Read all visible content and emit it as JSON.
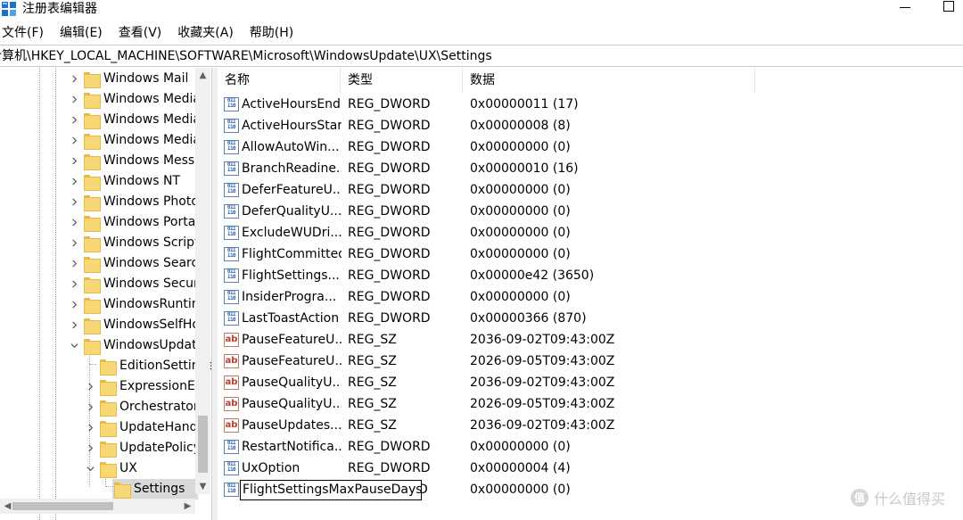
{
  "window": {
    "title": "注册表编辑器"
  },
  "menu": [
    "文件(F)",
    "编辑(E)",
    "查看(V)",
    "收藏夹(A)",
    "帮助(H)"
  ],
  "address": "计算机\\HKEY_LOCAL_MACHINE\\SOFTWARE\\Microsoft\\WindowsUpdate\\UX\\Settings",
  "tree": [
    {
      "label": "Windows Mail",
      "expanded": false
    },
    {
      "label": "Windows Media",
      "expanded": false
    },
    {
      "label": "Windows Media",
      "expanded": false
    },
    {
      "label": "Windows Media",
      "expanded": false
    },
    {
      "label": "Windows Messa",
      "expanded": false
    },
    {
      "label": "Windows NT",
      "expanded": false
    },
    {
      "label": "Windows Photo",
      "expanded": false
    },
    {
      "label": "Windows Portal",
      "expanded": false
    },
    {
      "label": "Windows Script",
      "expanded": false
    },
    {
      "label": "Windows Search",
      "expanded": false
    },
    {
      "label": "Windows Securi",
      "expanded": false
    },
    {
      "label": "WindowsRuntim",
      "expanded": false
    },
    {
      "label": "WindowsSelfHo",
      "expanded": false
    },
    {
      "label": "WindowsUpdate",
      "expanded": true
    },
    {
      "label": "EditionSettings",
      "expanded": false
    },
    {
      "label": "ExpressionEv",
      "expanded": false
    },
    {
      "label": "Orchestrator",
      "expanded": false
    },
    {
      "label": "UpdateHand",
      "expanded": false
    },
    {
      "label": "UpdatePolicy",
      "expanded": false
    },
    {
      "label": "UX",
      "expanded": true
    },
    {
      "label": "Settings",
      "expanded": false
    }
  ],
  "columns": {
    "name": "名称",
    "type": "类型",
    "data": "数据"
  },
  "values": [
    {
      "name": "ActiveHoursEnd",
      "type": "REG_DWORD",
      "data": "0x00000011 (17)",
      "kind": "dword"
    },
    {
      "name": "ActiveHoursStart",
      "type": "REG_DWORD",
      "data": "0x00000008 (8)",
      "kind": "dword"
    },
    {
      "name": "AllowAutoWin...",
      "type": "REG_DWORD",
      "data": "0x00000000 (0)",
      "kind": "dword"
    },
    {
      "name": "BranchReadine...",
      "type": "REG_DWORD",
      "data": "0x00000010 (16)",
      "kind": "dword"
    },
    {
      "name": "DeferFeatureU...",
      "type": "REG_DWORD",
      "data": "0x00000000 (0)",
      "kind": "dword"
    },
    {
      "name": "DeferQualityU...",
      "type": "REG_DWORD",
      "data": "0x00000000 (0)",
      "kind": "dword"
    },
    {
      "name": "ExcludeWUDri...",
      "type": "REG_DWORD",
      "data": "0x00000000 (0)",
      "kind": "dword"
    },
    {
      "name": "FlightCommitted",
      "type": "REG_DWORD",
      "data": "0x00000000 (0)",
      "kind": "dword"
    },
    {
      "name": "FlightSettings...",
      "type": "REG_DWORD",
      "data": "0x00000e42 (3650)",
      "kind": "dword"
    },
    {
      "name": "InsiderProgra...",
      "type": "REG_DWORD",
      "data": "0x00000000 (0)",
      "kind": "dword"
    },
    {
      "name": "LastToastAction",
      "type": "REG_DWORD",
      "data": "0x00000366 (870)",
      "kind": "dword"
    },
    {
      "name": "PauseFeatureU...",
      "type": "REG_SZ",
      "data": "2036-09-02T09:43:00Z",
      "kind": "sz"
    },
    {
      "name": "PauseFeatureU...",
      "type": "REG_SZ",
      "data": "2026-09-05T09:43:00Z",
      "kind": "sz"
    },
    {
      "name": "PauseQualityU...",
      "type": "REG_SZ",
      "data": "2036-09-02T09:43:00Z",
      "kind": "sz"
    },
    {
      "name": "PauseQualityU...",
      "type": "REG_SZ",
      "data": "2026-09-05T09:43:00Z",
      "kind": "sz"
    },
    {
      "name": "PauseUpdates...",
      "type": "REG_SZ",
      "data": "2036-09-02T09:43:00Z",
      "kind": "sz"
    },
    {
      "name": "RestartNotifica...",
      "type": "REG_DWORD",
      "data": "0x00000000 (0)",
      "kind": "dword"
    },
    {
      "name": "UxOption",
      "type": "REG_DWORD",
      "data": "0x00000004 (4)",
      "kind": "dword"
    }
  ],
  "editing_row": {
    "name_input": "FlightSettingsMaxPauseDays",
    "type_tail": "D",
    "data": "0x00000000 (0)",
    "kind": "dword"
  },
  "watermark": {
    "badge": "值",
    "text": "什么值得买"
  }
}
